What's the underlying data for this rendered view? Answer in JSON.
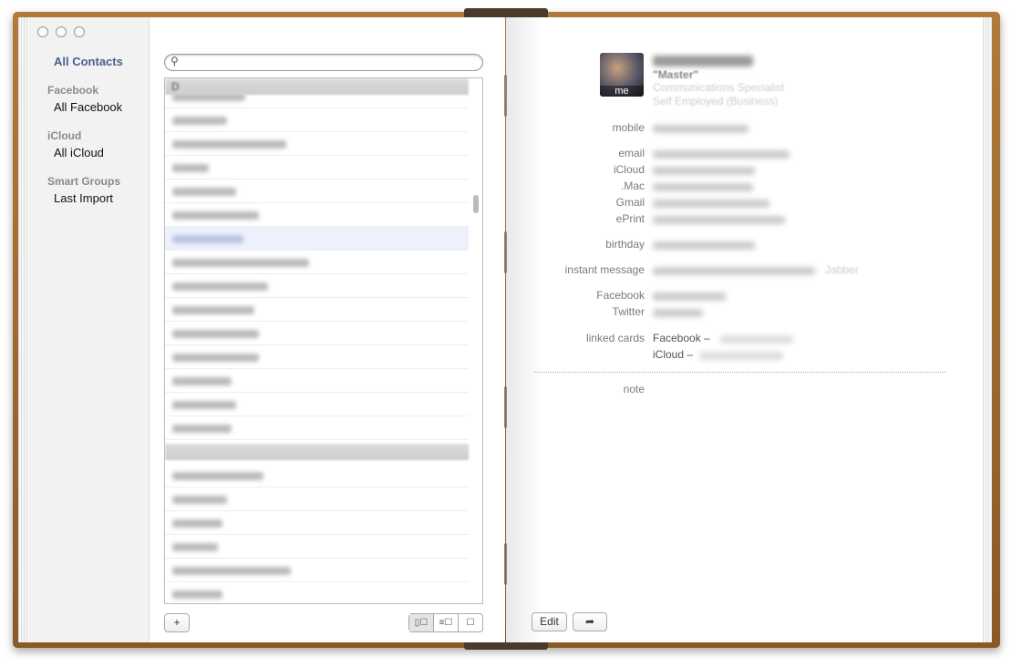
{
  "sidebar": {
    "all_contacts": "All Contacts",
    "groups": [
      {
        "header": "Facebook",
        "item": "All Facebook"
      },
      {
        "header": "iCloud",
        "item": "All iCloud"
      },
      {
        "header": "Smart Groups",
        "item": "Last Import"
      }
    ]
  },
  "list": {
    "search_placeholder": "",
    "section_headers": [
      "D"
    ],
    "selected_index": 6
  },
  "toolbar": {
    "add": "+",
    "views": [
      "▯☐",
      "≡☐",
      "☐"
    ],
    "edit": "Edit",
    "share": "➦"
  },
  "card": {
    "avatar_badge": "me",
    "nickname": "\"Master\"",
    "job_title": "Communications Specialist",
    "company": "Self Employed (Business)",
    "labels": {
      "mobile": "mobile",
      "email": "email",
      "icloud": "iCloud",
      "mac": ".Mac",
      "gmail": "Gmail",
      "eprint": "ePrint",
      "birthday": "birthday",
      "im": "instant message",
      "facebook": "Facebook",
      "twitter": "Twitter",
      "linked": "linked cards",
      "note": "note"
    },
    "im_service": "Jabber",
    "linked_cards": [
      "Facebook –",
      "iCloud –"
    ]
  },
  "colors": {
    "accent": "#4a5f8e",
    "selection": "#eef1fb",
    "leather": "#8a5a26"
  }
}
